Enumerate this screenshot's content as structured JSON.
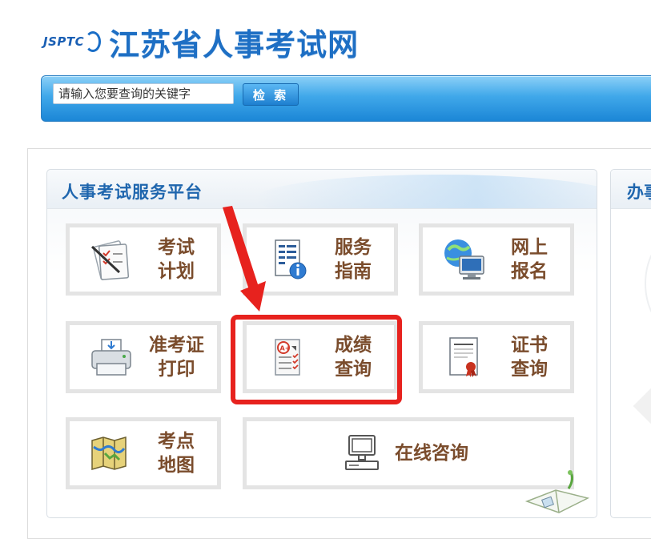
{
  "header": {
    "logo_mark": "JSPTC",
    "site_title": "江苏省人事考试网"
  },
  "search": {
    "placeholder": "请输入您要查询的关键字",
    "button_label": "检 索"
  },
  "panel": {
    "title": "人事考试服务平台",
    "tiles": [
      {
        "line1": "考试",
        "line2": "计划",
        "icon": "exam-plan-icon"
      },
      {
        "line1": "服务",
        "line2": "指南",
        "icon": "service-guide-icon"
      },
      {
        "line1": "网上",
        "line2": "报名",
        "icon": "online-registration-icon"
      },
      {
        "line1": "准考证",
        "line2": "打印",
        "icon": "printer-icon"
      },
      {
        "line1": "成绩",
        "line2": "查询",
        "icon": "score-query-icon"
      },
      {
        "line1": "证书",
        "line2": "查询",
        "icon": "certificate-icon"
      },
      {
        "line1": "考点",
        "line2": "地图",
        "icon": "map-icon"
      },
      {
        "line1": "在线咨询",
        "icon": "computer-icon"
      }
    ]
  },
  "right_panel": {
    "title": "办事"
  },
  "colors": {
    "brand_blue": "#1e6fc4",
    "tile_text": "#7a4c2c",
    "highlight_red": "#e7221e"
  }
}
